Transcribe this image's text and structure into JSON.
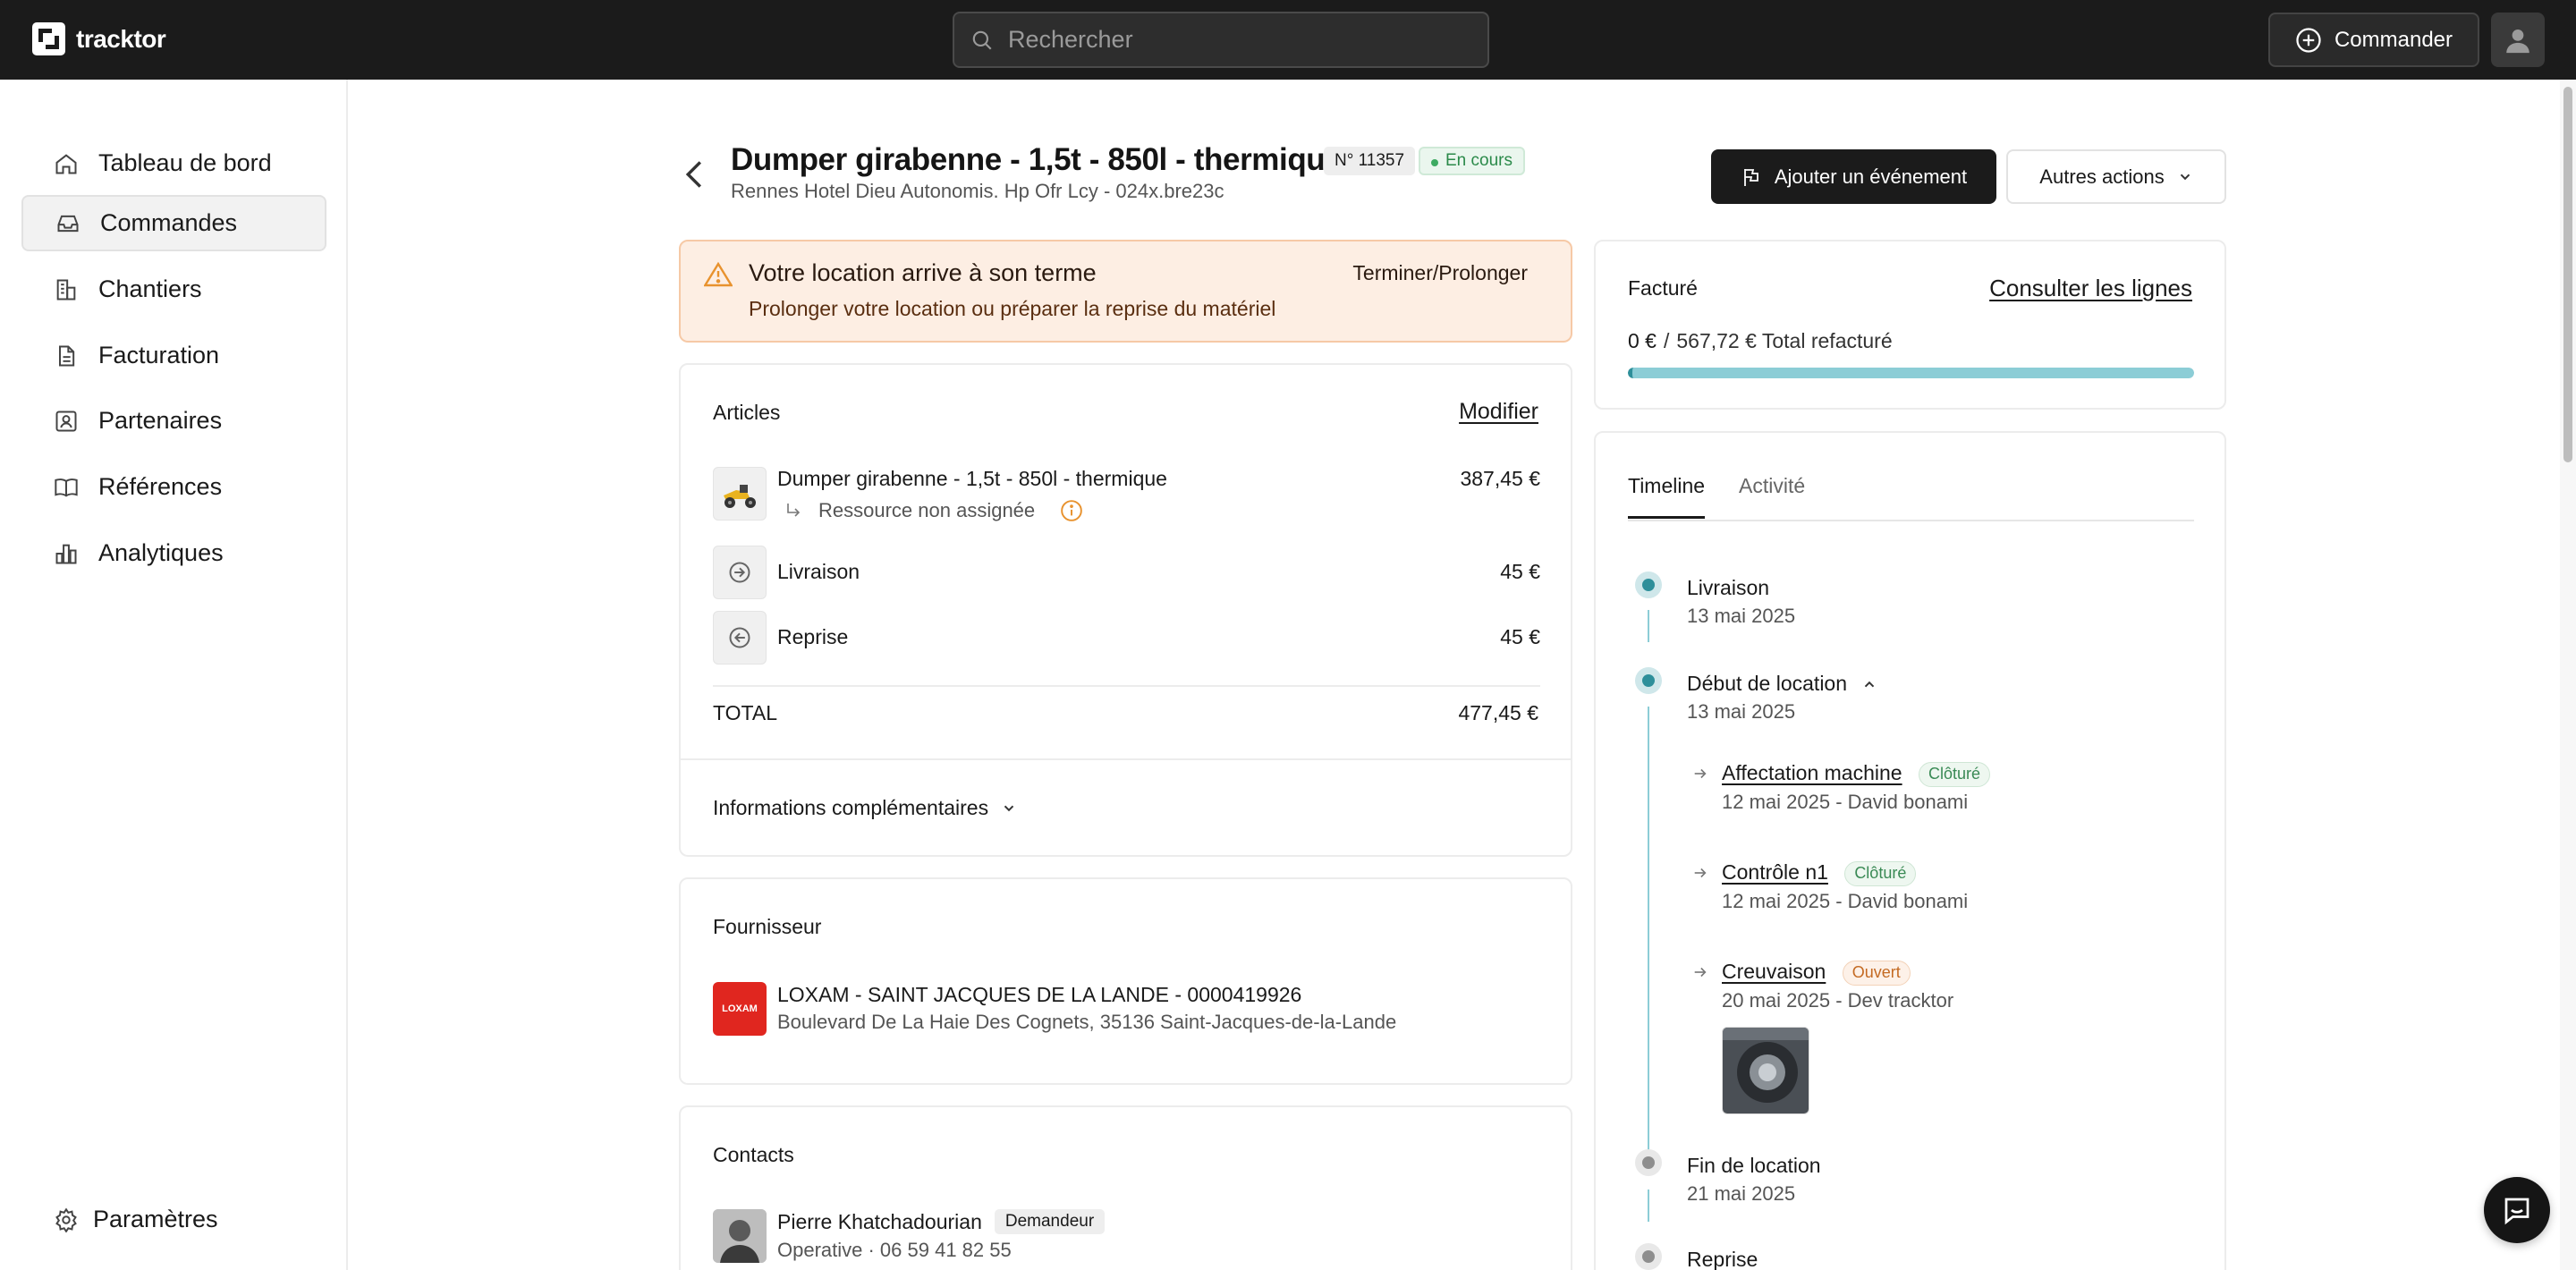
{
  "app": {
    "name": "tracktor"
  },
  "search": {
    "placeholder": "Rechercher"
  },
  "header": {
    "commander_label": "Commander"
  },
  "sidebar": {
    "items": [
      {
        "label": "Tableau de bord",
        "icon": "home-icon"
      },
      {
        "label": "Commandes",
        "icon": "inbox-icon",
        "active": true
      },
      {
        "label": "Chantiers",
        "icon": "building-icon"
      },
      {
        "label": "Facturation",
        "icon": "document-icon"
      },
      {
        "label": "Partenaires",
        "icon": "contact-card-icon"
      },
      {
        "label": "Références",
        "icon": "book-icon"
      },
      {
        "label": "Analytiques",
        "icon": "bar-chart-icon"
      }
    ],
    "settings_label": "Paramètres"
  },
  "order": {
    "title": "Dumper girabenne - 1,5t - 850l - thermique",
    "number": "N° 11357",
    "status": "En cours",
    "subtitle": "Rennes Hotel Dieu Autonomis. Hp Ofr Lcy - 024x.bre23c",
    "add_event_label": "Ajouter un événement",
    "other_actions_label": "Autres actions"
  },
  "alert": {
    "title": "Votre location arrive à son terme",
    "text": "Prolonger votre location ou préparer la reprise du matériel",
    "action": "Terminer/Prolonger"
  },
  "articles": {
    "heading": "Articles",
    "edit_label": "Modifier",
    "items": [
      {
        "name": "Dumper girabenne - 1,5t - 850l - thermique",
        "price": "387,45 €",
        "sub": "Ressource non assignée"
      },
      {
        "name": "Livraison",
        "price": "45 €"
      },
      {
        "name": "Reprise",
        "price": "45 €"
      }
    ],
    "total_label": "TOTAL",
    "total_value": "477,45 €",
    "more_info_label": "Informations complémentaires"
  },
  "supplier": {
    "heading": "Fournisseur",
    "logo_text": "LOXAM",
    "name": "LOXAM - SAINT JACQUES DE LA LANDE - 0000419926",
    "address": "Boulevard De La Haie Des Cognets, 35136 Saint-Jacques-de-la-Lande"
  },
  "contacts": {
    "heading": "Contacts",
    "items": [
      {
        "name": "Pierre Khatchadourian",
        "role": "Demandeur",
        "detail": "Operative · 06 59 41 82 55"
      }
    ]
  },
  "billing": {
    "heading": "Facturé",
    "link": "Consulter les lignes",
    "amount": "0 €",
    "separator": "/",
    "total": "567,72 € Total refacturé",
    "progress": 1.0
  },
  "timeline": {
    "tabs": [
      "Timeline",
      "Activité"
    ],
    "events": [
      {
        "title": "Livraison",
        "date": "13 mai 2025"
      },
      {
        "title": "Début de location",
        "date": "13 mai 2025"
      },
      {
        "title": "Fin de location",
        "date": "21 mai 2025"
      },
      {
        "title": "Reprise"
      }
    ],
    "sub_events": [
      {
        "title": "Affectation machine",
        "tag": "Clôturé",
        "detail": "12 mai 2025 - David bonami"
      },
      {
        "title": "Contrôle n1",
        "tag": "Clôturé",
        "detail": "12 mai 2025 - David bonami"
      },
      {
        "title": "Creuvaison",
        "tag": "Ouvert",
        "detail": "20 mai 2025 - Dev tracktor"
      }
    ]
  },
  "colors": {
    "accent": "#2e8f9a",
    "topbar": "#1b1b1b",
    "warning": "#f0a030",
    "loxam": "#e0261f"
  }
}
